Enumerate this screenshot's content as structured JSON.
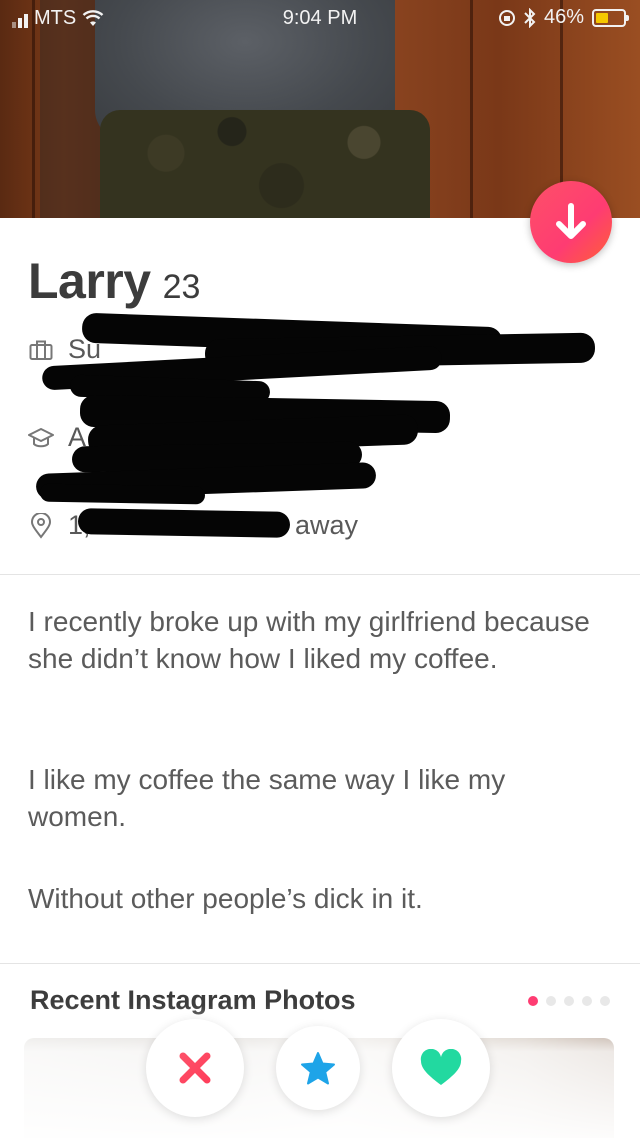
{
  "status_bar": {
    "carrier": "MTS",
    "time": "9:04 PM",
    "battery": "46%",
    "battery_level": 0.46
  },
  "profile": {
    "name": "Larry",
    "age": "23",
    "job_text": "Su",
    "school_text": "A",
    "distance_prefix": "1,",
    "distance_suffix": "away",
    "icons": {
      "job": "briefcase-icon",
      "school": "graduation-cap-icon",
      "location": "location-pin-icon"
    }
  },
  "bio": [
    "I recently broke up with my girlfriend because she didn’t know how I liked my coffee.",
    "I like my coffee the same way I like my women.",
    "Without other people’s dick in it."
  ],
  "instagram": {
    "title": "Recent Instagram Photos",
    "page_count": 5,
    "active_page": 1
  },
  "actions": {
    "nope": "close-icon",
    "super_like": "star-icon",
    "like": "heart-icon"
  },
  "colors": {
    "accent": "#fe3c72",
    "nope": "#fd5068",
    "super_like": "#1ea4e8",
    "like": "#22d9a0"
  }
}
